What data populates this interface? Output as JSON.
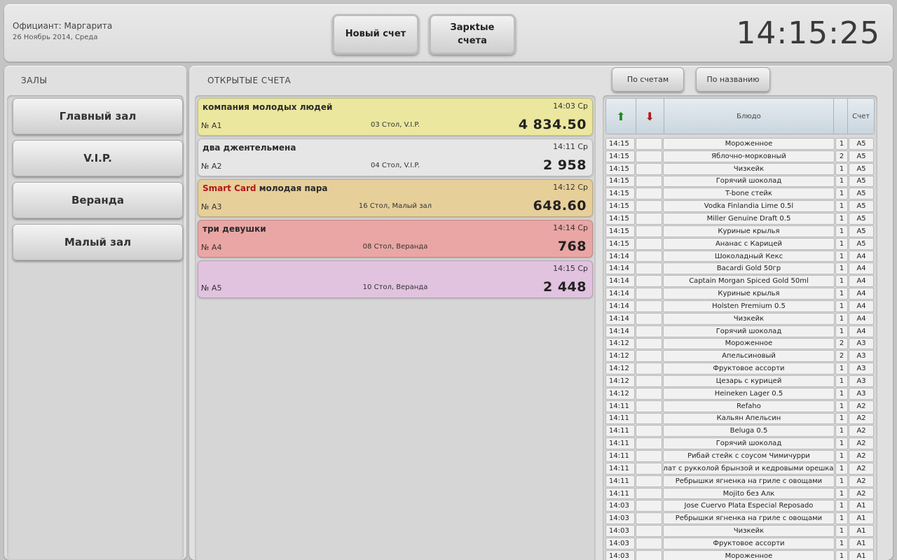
{
  "header": {
    "waiter": "Официант: Маргарита",
    "date": "26 Ноябрь 2014, Среда",
    "new_bill": "Новый счет",
    "closed_bills_line1": "Заркtые",
    "closed_bills_line2": "счета",
    "clock": "14:15:25"
  },
  "halls": {
    "title": "ЗАЛЫ",
    "items": [
      "Главный зал",
      "V.I.P.",
      "Веранда",
      "Малый зал"
    ]
  },
  "bills": {
    "title": "ОТКРЫТЫЕ СЧЕТА",
    "sort_by_bill": "По счетам",
    "sort_by_name": "По названию",
    "items": [
      {
        "card": "",
        "name": "компания молодых людей",
        "time": "14:03 Ср",
        "number": "№ А1",
        "table": "03 Стол, V.I.P.",
        "sum": "4 834.50",
        "color": "#ebe79f"
      },
      {
        "card": "",
        "name": "два джентельмена",
        "time": "14:11 Ср",
        "number": "№ А2",
        "table": "04 Стол, V.I.P.",
        "sum": "2 958",
        "color": "#e6e6e6"
      },
      {
        "card": "Smart Card",
        "name": "молодая пара",
        "time": "14:12 Ср",
        "number": "№ А3",
        "table": "16 Стол, Малый зал",
        "sum": "648.60",
        "color": "#e7cf9a"
      },
      {
        "card": "",
        "name": "три девушки",
        "time": "14:14 Ср",
        "number": "№ А4",
        "table": "08 Стол, Веранда",
        "sum": "768",
        "color": "#e9a6a4"
      },
      {
        "card": "",
        "name": "",
        "time": "14:15 Ср",
        "number": "№ А5",
        "table": "10 Стол, Веранда",
        "sum": "2 448",
        "color": "#e1c2df"
      }
    ]
  },
  "dishes": {
    "col_dish": "Блюдо",
    "col_bill": "Счет",
    "up_icon": "arrow-up-icon",
    "down_icon": "arrow-down-icon",
    "up_color": "#1f8a1f",
    "down_color": "#b01818",
    "rows": [
      [
        "14:15",
        "Мороженное",
        "1",
        "А5"
      ],
      [
        "14:15",
        "Яблочно-морковный",
        "2",
        "А5"
      ],
      [
        "14:15",
        "Чизкейк",
        "1",
        "А5"
      ],
      [
        "14:15",
        "Горячий шоколад",
        "1",
        "А5"
      ],
      [
        "14:15",
        "T-bone стейк",
        "1",
        "А5"
      ],
      [
        "14:15",
        "Vodka Finlandia Lime  0.5l",
        "1",
        "А5"
      ],
      [
        "14:15",
        "Miller Genuine Draft  0.5",
        "1",
        "А5"
      ],
      [
        "14:15",
        "Куриные крылья",
        "1",
        "А5"
      ],
      [
        "14:15",
        "Ананас с Карицей",
        "1",
        "А5"
      ],
      [
        "14:14",
        "Шоколадный Кекс",
        "1",
        "А4"
      ],
      [
        "14:14",
        "Bacardi Gold 50гр",
        "1",
        "А4"
      ],
      [
        "14:14",
        "Captain Morgan Spiced Gold  50ml",
        "1",
        "А4"
      ],
      [
        "14:14",
        "Куриные крылья",
        "1",
        "А4"
      ],
      [
        "14:14",
        "Holsten Premium  0.5",
        "1",
        "А4"
      ],
      [
        "14:14",
        "Чизкейк",
        "1",
        "А4"
      ],
      [
        "14:14",
        "Горячий шоколад",
        "1",
        "А4"
      ],
      [
        "14:12",
        "Мороженное",
        "2",
        "А3"
      ],
      [
        "14:12",
        "Апельсиновый",
        "2",
        "А3"
      ],
      [
        "14:12",
        "Фруктовое ассорти",
        "1",
        "А3"
      ],
      [
        "14:12",
        "Цезарь с курицей",
        "1",
        "А3"
      ],
      [
        "14:12",
        "Heineken Lager  0.5",
        "1",
        "А3"
      ],
      [
        "14:11",
        "Refaho",
        "1",
        "А2"
      ],
      [
        "14:11",
        "Кальян Апельсин",
        "1",
        "А2"
      ],
      [
        "14:11",
        "Beluga  0.5",
        "1",
        "А2"
      ],
      [
        "14:11",
        "Горячий шоколад",
        "1",
        "А2"
      ],
      [
        "14:11",
        "Рибай стейк с соусом Чимичурри",
        "1",
        "А2"
      ],
      [
        "14:11",
        "Салат с рукколой брынзой и кедровыми орешками",
        "1",
        "А2"
      ],
      [
        "14:11",
        "Ребрышки ягненка на гриле с овощами",
        "1",
        "А2"
      ],
      [
        "14:11",
        "Mojito без Алк",
        "1",
        "А2"
      ],
      [
        "14:03",
        "Jose Cuervo Plata Especial Reposado",
        "1",
        "А1"
      ],
      [
        "14:03",
        "Ребрышки ягненка на гриле с овощами",
        "1",
        "А1"
      ],
      [
        "14:03",
        "Чизкейк",
        "1",
        "А1"
      ],
      [
        "14:03",
        "Фруктовое ассорти",
        "1",
        "А1"
      ],
      [
        "14:03",
        "Мороженное",
        "1",
        "А1"
      ]
    ]
  }
}
